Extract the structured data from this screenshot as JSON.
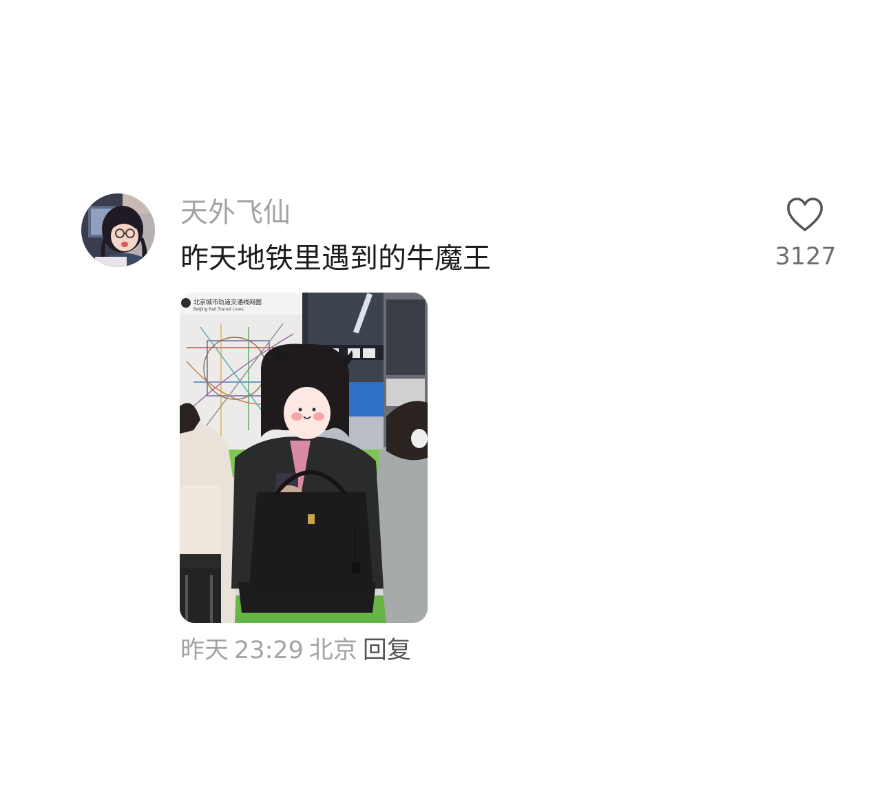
{
  "comment": {
    "username": "天外飞仙",
    "text": "昨天地铁里遇到的牛魔王",
    "like_count": "3127",
    "like_icon": "heart-outline-icon",
    "meta": {
      "date": "昨天",
      "time": "23:29",
      "location": "北京",
      "reply_label": "回复"
    },
    "image": {
      "map_title": "北京城市轨道交通线网图",
      "map_subtitle": "Beijing Rail Transit Lines"
    }
  }
}
